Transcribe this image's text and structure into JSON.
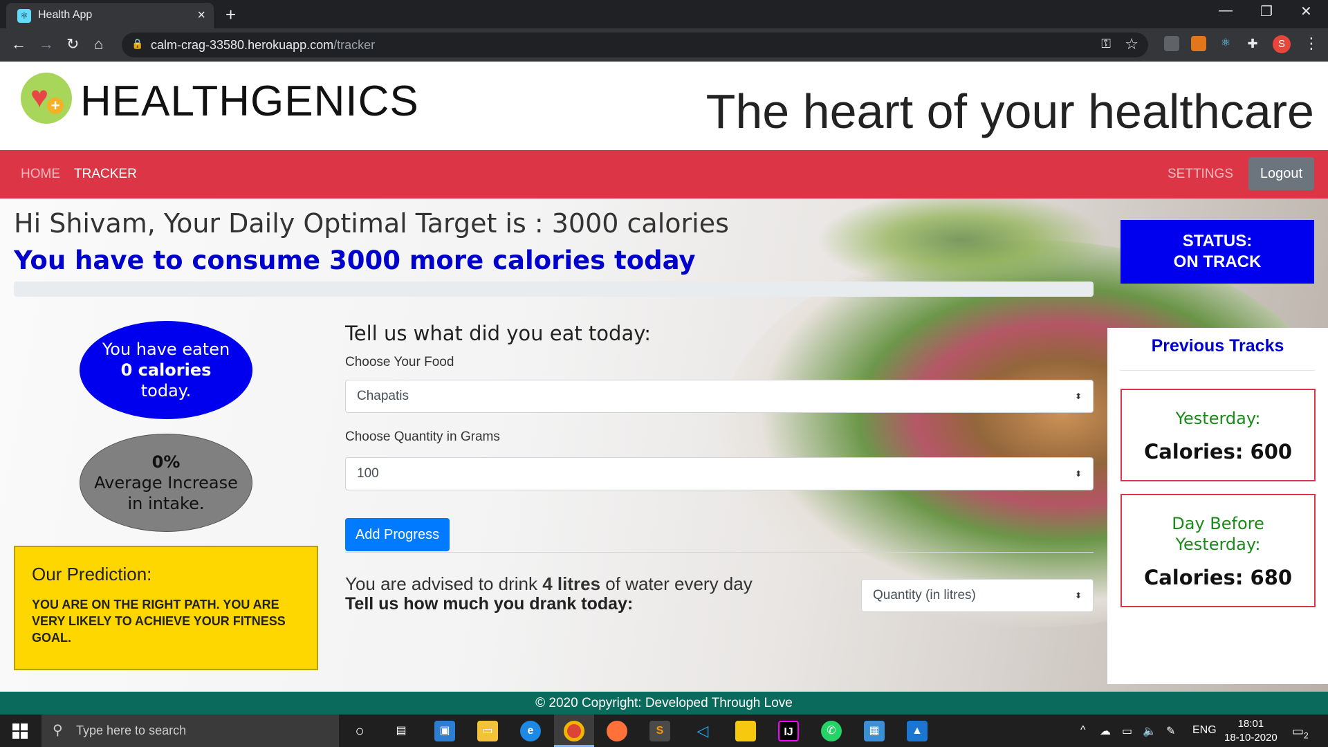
{
  "browser": {
    "tab_title": "Health App",
    "tab_close": "×",
    "new_tab": "+",
    "url_host": "calm-crag-33580.herokuapp.com",
    "url_path": "/tracker",
    "window_controls": {
      "minimize": "—",
      "restore": "❐",
      "close": "✕"
    },
    "profile_initial": "S"
  },
  "header": {
    "brand": "HEALTHGENICS",
    "tagline": "The heart of your healthcare"
  },
  "nav": {
    "home": "HOME",
    "tracker": "TRACKER",
    "settings": "SETTINGS",
    "logout": "Logout"
  },
  "summary": {
    "greeting": "Hi Shivam, Your Daily Optimal Target is : 3000 calories",
    "remaining": "You have to consume 3000 more calories today",
    "progress_fraction": 0
  },
  "status": {
    "line1": "STATUS:",
    "line2": "ON TRACK"
  },
  "eaten": {
    "line1": "You have eaten",
    "line2": "0 calories",
    "line3": "today."
  },
  "average": {
    "line1": "0%",
    "line2": "Average Increase",
    "line3": "in intake."
  },
  "prediction": {
    "heading": "Our Prediction:",
    "text": "YOU ARE ON THE RIGHT PATH. YOU ARE VERY LIKELY TO ACHIEVE YOUR FITNESS GOAL."
  },
  "form": {
    "heading": "Tell us what did you eat today:",
    "food_label": "Choose Your Food",
    "food_value": "Chapatis",
    "qty_label": "Choose Quantity in Grams",
    "qty_value": "100",
    "add_button": "Add Progress",
    "water_advice_prefix": "You are advised to drink ",
    "water_advice_amount": "4 litres",
    "water_advice_suffix": " of water every day",
    "water_question": "Tell us how much you drank today:",
    "water_placeholder": "Quantity (in litres)"
  },
  "previous": {
    "heading": "Previous Tracks",
    "yesterday_label": "Yesterday:",
    "yesterday_value": "Calories: 600",
    "day_before_label_1": "Day Before",
    "day_before_label_2": "Yesterday:",
    "day_before_value": "Calories: 680"
  },
  "footer": {
    "text": "© 2020 Copyright: Developed Through Love"
  },
  "taskbar": {
    "search_placeholder": "Type here to search",
    "lang": "ENG",
    "time": "18:01",
    "date": "18-10-2020",
    "notifications": "2"
  },
  "colors": {
    "nav": "#dc3545",
    "status": "#0000ee",
    "prediction": "#ffd700",
    "footer": "#0a6b5c",
    "primary_button": "#007bff"
  }
}
